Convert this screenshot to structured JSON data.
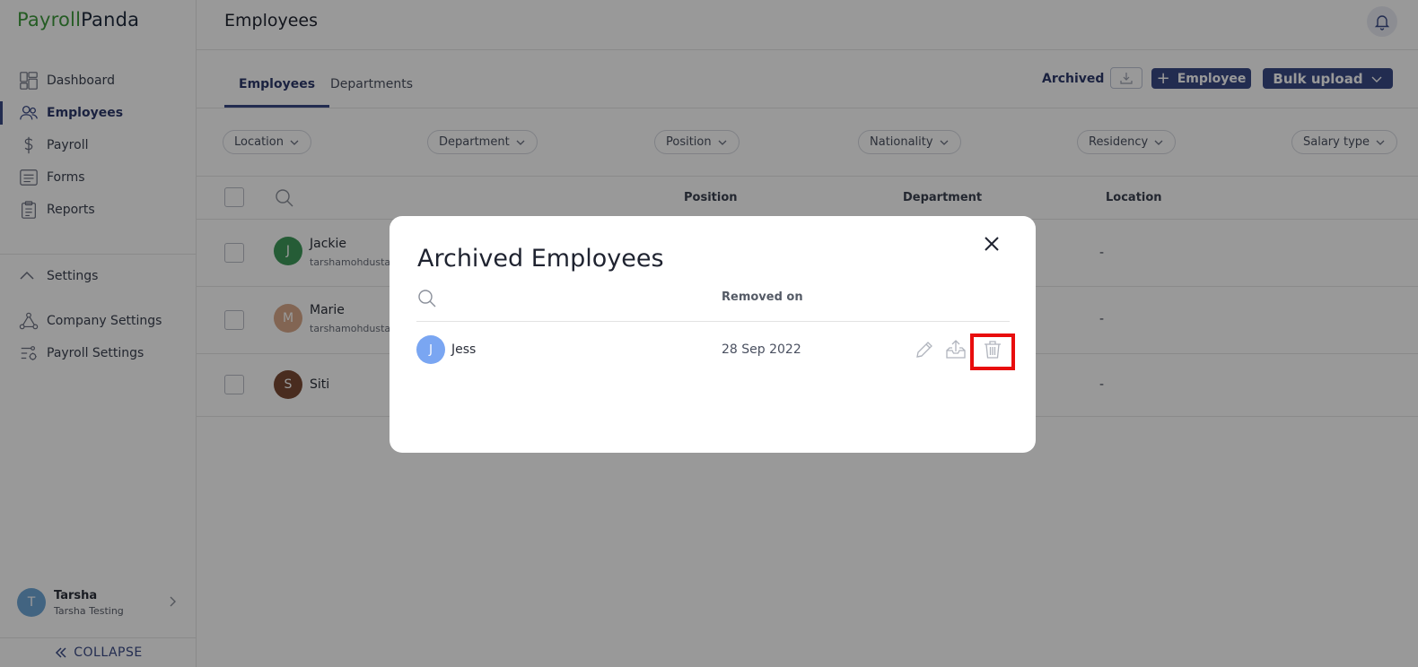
{
  "app": {
    "logo_part1": "Payroll",
    "logo_part2": "Panda"
  },
  "sidebar": {
    "items": [
      {
        "label": "Dashboard",
        "icon": "dashboard-icon"
      },
      {
        "label": "Employees",
        "icon": "users-icon",
        "active": true
      },
      {
        "label": "Payroll",
        "icon": "dollar-icon"
      },
      {
        "label": "Forms",
        "icon": "forms-icon"
      },
      {
        "label": "Reports",
        "icon": "clipboard-icon"
      }
    ],
    "settings_label": "Settings",
    "settings_items": [
      {
        "label": "Company Settings",
        "icon": "network-icon"
      },
      {
        "label": "Payroll Settings",
        "icon": "sliders-gear-icon"
      }
    ],
    "user": {
      "initial": "T",
      "name": "Tarsha",
      "company": "Tarsha Testing"
    },
    "collapse_label": "COLLAPSE"
  },
  "header": {
    "title": "Employees"
  },
  "tabs": [
    {
      "label": "Employees",
      "active": true
    },
    {
      "label": "Departments",
      "active": false
    }
  ],
  "toolbar": {
    "archived_label": "Archived",
    "add_label": "Employee",
    "bulk_label": "Bulk upload"
  },
  "filters": [
    "Location",
    "Department",
    "Position",
    "Nationality",
    "Residency",
    "Salary type"
  ],
  "table": {
    "columns": [
      "Position",
      "Department",
      "Location"
    ],
    "rows": [
      {
        "initial": "J",
        "name": "Jackie",
        "email": "tarshamohdustar",
        "location": "-",
        "avatar_color": "#3f9a5a"
      },
      {
        "initial": "M",
        "name": "Marie",
        "email": "tarshamohdustar",
        "location": "-",
        "avatar_color": "#d9a98a"
      },
      {
        "initial": "S",
        "name": "Siti",
        "email": "",
        "location": "-",
        "avatar_color": "#7a4a35"
      }
    ]
  },
  "modal": {
    "title": "Archived Employees",
    "column_removed": "Removed on",
    "rows": [
      {
        "initial": "J",
        "name": "Jess",
        "removed_on": "28 Sep 2022"
      }
    ]
  },
  "colors": {
    "primary": "#3a4a86",
    "brand_green": "#3f9a3c",
    "highlight": "#e80d0d"
  }
}
